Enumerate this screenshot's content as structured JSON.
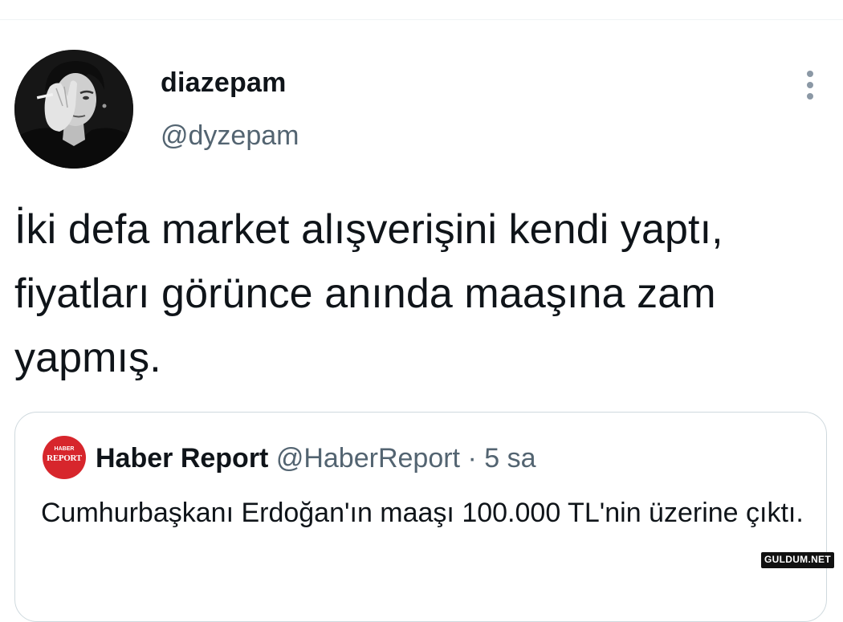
{
  "author": {
    "display_name": "diazepam",
    "handle": "@dyzepam"
  },
  "tweet": {
    "text": "İki defa market alışverişini kendi yaptı, fiyatları görünce anında maaşına zam yapmış."
  },
  "quote": {
    "logo_top": "HABER",
    "logo_main": "REPORT",
    "name": "Haber Report",
    "handle": "@HaberReport",
    "separator": "·",
    "time": "5 sa",
    "text": "Cumhurbaşkanı Erdoğan'ın maaşı 100.000 TL'nin üzerine çıktı."
  },
  "watermark": "GULDUM.NET",
  "icons": {
    "more": "more-vertical-icon"
  },
  "colors": {
    "text": "#0f1419",
    "secondary": "#536471",
    "border": "#cfd9de",
    "logo": "#d7262c"
  }
}
